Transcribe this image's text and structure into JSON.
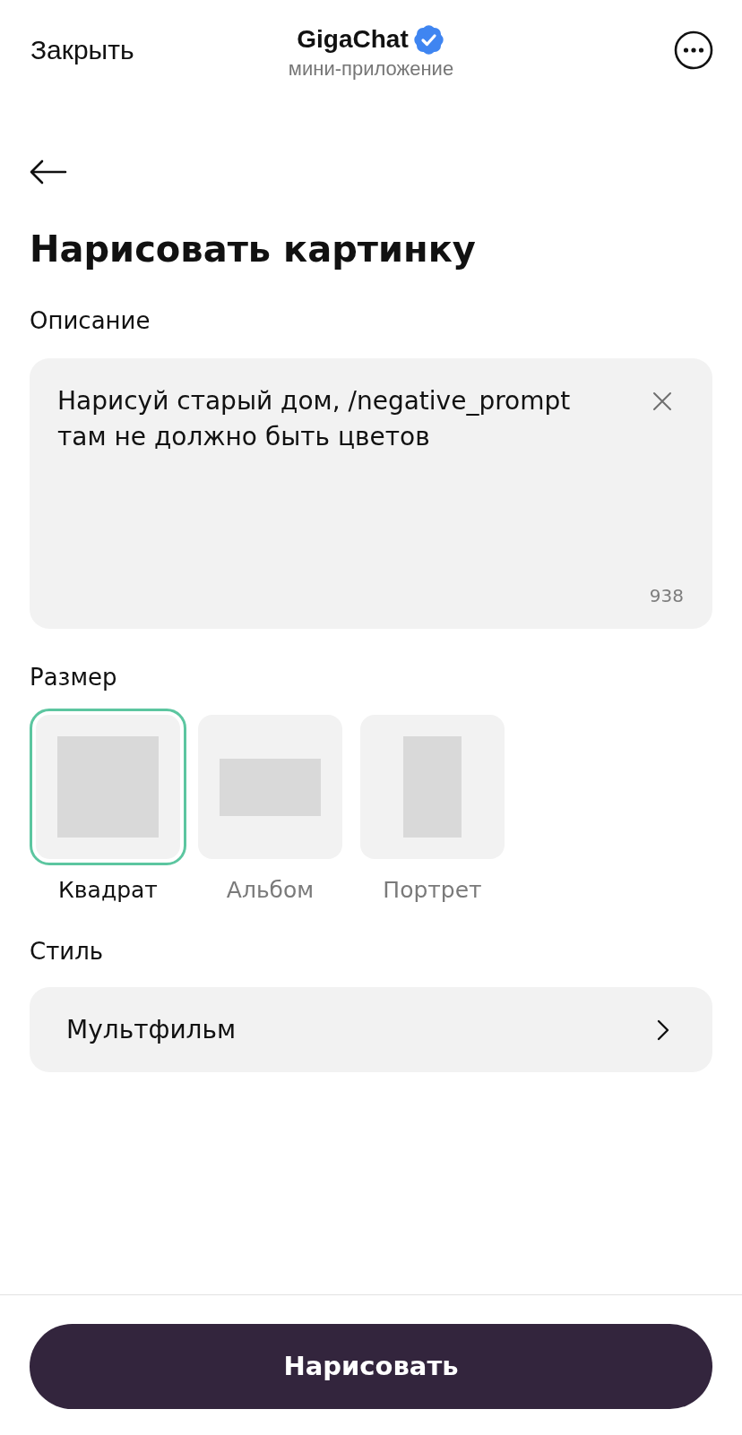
{
  "header": {
    "close": "Закрыть",
    "title": "GigaChat",
    "subtitle": "мини-приложение"
  },
  "page_title": "Нарисовать картинку",
  "description": {
    "label": "Описание",
    "value": "Нарисуй старый дом, /negative_prompt там не должно быть цветов",
    "counter": "938"
  },
  "size": {
    "label": "Размер",
    "options": [
      {
        "kind": "square",
        "label": "Квадрат",
        "selected": true
      },
      {
        "kind": "landscape",
        "label": "Альбом",
        "selected": false
      },
      {
        "kind": "portrait",
        "label": "Портрет",
        "selected": false
      }
    ]
  },
  "style": {
    "label": "Стиль",
    "value": "Мультфильм"
  },
  "submit": {
    "label": "Нарисовать"
  }
}
